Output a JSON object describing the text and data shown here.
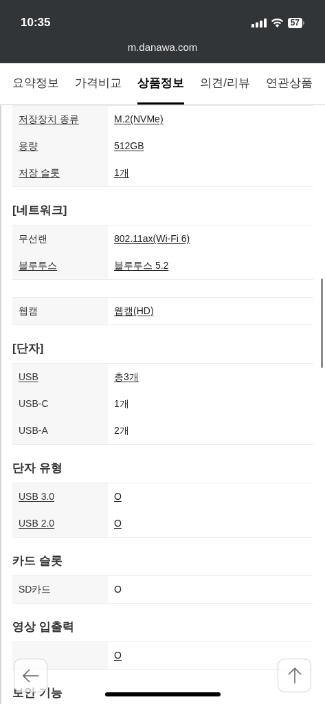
{
  "status_bar": {
    "time": "10:35",
    "battery": "57"
  },
  "address_bar": {
    "url": "m.danawa.com"
  },
  "tabs": [
    {
      "label": "요약정보",
      "selected": false
    },
    {
      "label": "가격비교",
      "selected": false
    },
    {
      "label": "상품정보",
      "selected": true
    },
    {
      "label": "의견/리뷰",
      "selected": false
    },
    {
      "label": "연관상품",
      "selected": false
    }
  ],
  "sections": [
    {
      "rows": [
        {
          "label": "저장장치 종류",
          "value": "M.2(NVMe)",
          "label_link": true,
          "value_link": true
        },
        {
          "label": "용량",
          "value": "512GB",
          "label_link": true,
          "value_link": true
        },
        {
          "label": "저장 슬롯",
          "value": "1개",
          "label_link": true,
          "value_link": true
        }
      ]
    },
    {
      "title": "[네트워크]",
      "rows": [
        {
          "label": "무선랜",
          "value": "802.11ax(Wi-Fi 6)",
          "label_link": false,
          "value_link": true
        },
        {
          "label": "블루투스",
          "value": "블루투스 5.2",
          "label_link": true,
          "value_link": true
        }
      ]
    },
    {
      "rows": [
        {
          "label": "웹캠",
          "value": "웹캠(HD)",
          "label_link": false,
          "value_link": true
        }
      ]
    },
    {
      "title": "[단자]",
      "rows": [
        {
          "label": "USB",
          "value": "총3개",
          "label_link": true,
          "value_link": true
        },
        {
          "label": "USB-C",
          "value": "1개",
          "label_link": false,
          "value_link": false
        },
        {
          "label": "USB-A",
          "value": "2개",
          "label_link": false,
          "value_link": false
        }
      ]
    },
    {
      "title": "단자 유형",
      "rows": [
        {
          "label": "USB 3.0",
          "value": "O",
          "label_link": true,
          "value_link": true
        },
        {
          "label": "USB 2.0",
          "value": "O",
          "label_link": true,
          "value_link": true
        }
      ]
    },
    {
      "title": "카드 슬롯",
      "rows": [
        {
          "label": "SD카드",
          "value": "O",
          "label_link": false,
          "value_link": false
        }
      ]
    },
    {
      "title": "영상 입출력",
      "rows": [
        {
          "value": "O",
          "value_link": true
        }
      ]
    },
    {
      "title": "보안 기능"
    }
  ]
}
